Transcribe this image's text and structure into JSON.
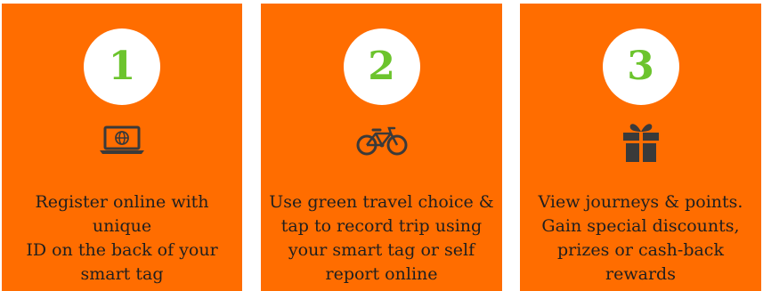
{
  "colors": {
    "panel_background": "#ff6d00",
    "number_green": "#6cc42d",
    "circle_white": "#ffffff",
    "icon_dark": "#3a3a3a",
    "text_dark": "#1f1f1f"
  },
  "steps": [
    {
      "number": "1",
      "icon": "laptop-globe-icon",
      "text": "Register online with unique\nID on the back of your\nsmart tag"
    },
    {
      "number": "2",
      "icon": "bicycle-icon",
      "text": "Use green travel choice &\ntap to record trip using\nyour   smart tag  or self\nreport online"
    },
    {
      "number": "3",
      "icon": "gift-icon",
      "text": "View journeys & points.\nGain special discounts,\nprizes or cash-back rewards"
    }
  ]
}
